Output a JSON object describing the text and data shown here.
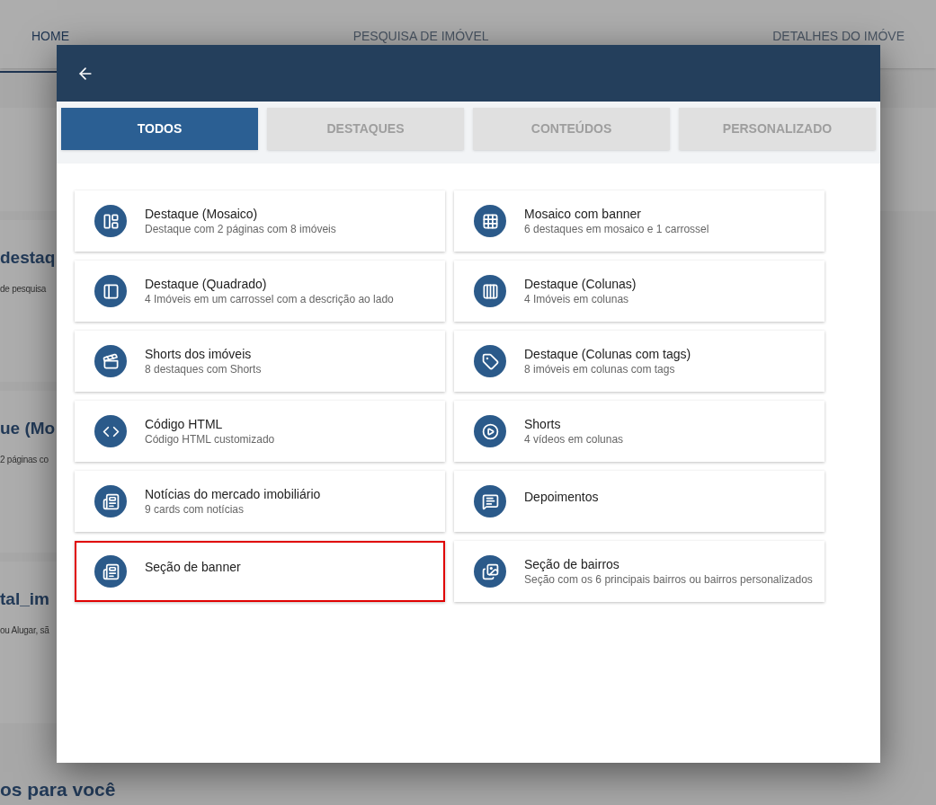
{
  "background": {
    "tabs": [
      {
        "label": "HOME",
        "selected": true
      },
      {
        "label": "PESQUISA DE IMÓVEL",
        "selected": false
      },
      {
        "label": "DETALHES DO IMÓVE",
        "selected": false
      }
    ],
    "cards": [
      {
        "title": "destaq",
        "subtitle": "de pesquisa"
      },
      {
        "title": "ue (Mo",
        "subtitle": "2 páginas co"
      },
      {
        "title": "tal_im",
        "subtitle": "ou Alugar, sã"
      }
    ],
    "footer_heading": "os para você"
  },
  "dialog": {
    "tabs": [
      {
        "label": "TODOS",
        "selected": true
      },
      {
        "label": "DESTAQUES",
        "selected": false
      },
      {
        "label": "CONTEÚDOS",
        "selected": false
      },
      {
        "label": "PERSONALIZADO",
        "selected": false
      }
    ],
    "items": [
      {
        "title": "Destaque (Mosaico)",
        "subtitle": "Destaque com 2 páginas com 8 imóveis",
        "highlighted": false
      },
      {
        "title": "Mosaico com banner",
        "subtitle": "6 destaques em mosaico e 1 carrossel",
        "highlighted": false
      },
      {
        "title": "Destaque (Quadrado)",
        "subtitle": "4 Imóveis em um carrossel com a descrição ao lado",
        "highlighted": false
      },
      {
        "title": "Destaque (Colunas)",
        "subtitle": "4 Imóveis em colunas",
        "highlighted": false
      },
      {
        "title": "Shorts dos imóveis",
        "subtitle": "8 destaques com Shorts",
        "highlighted": false
      },
      {
        "title": "Destaque (Colunas com tags)",
        "subtitle": "8 imóveis em colunas com tags",
        "highlighted": false
      },
      {
        "title": "Código HTML",
        "subtitle": "Código HTML customizado",
        "highlighted": false
      },
      {
        "title": "Shorts",
        "subtitle": "4 vídeos em colunas",
        "highlighted": false
      },
      {
        "title": "Notícias do mercado imobiliário",
        "subtitle": "9 cards com notícias",
        "highlighted": false
      },
      {
        "title": "Depoimentos",
        "highlighted": false
      },
      {
        "title": "Seção de banner",
        "highlighted": true
      },
      {
        "title": "Seção de bairros",
        "subtitle": "Seção com os 6 principais bairros ou bairros personalizados",
        "highlighted": false
      }
    ]
  }
}
